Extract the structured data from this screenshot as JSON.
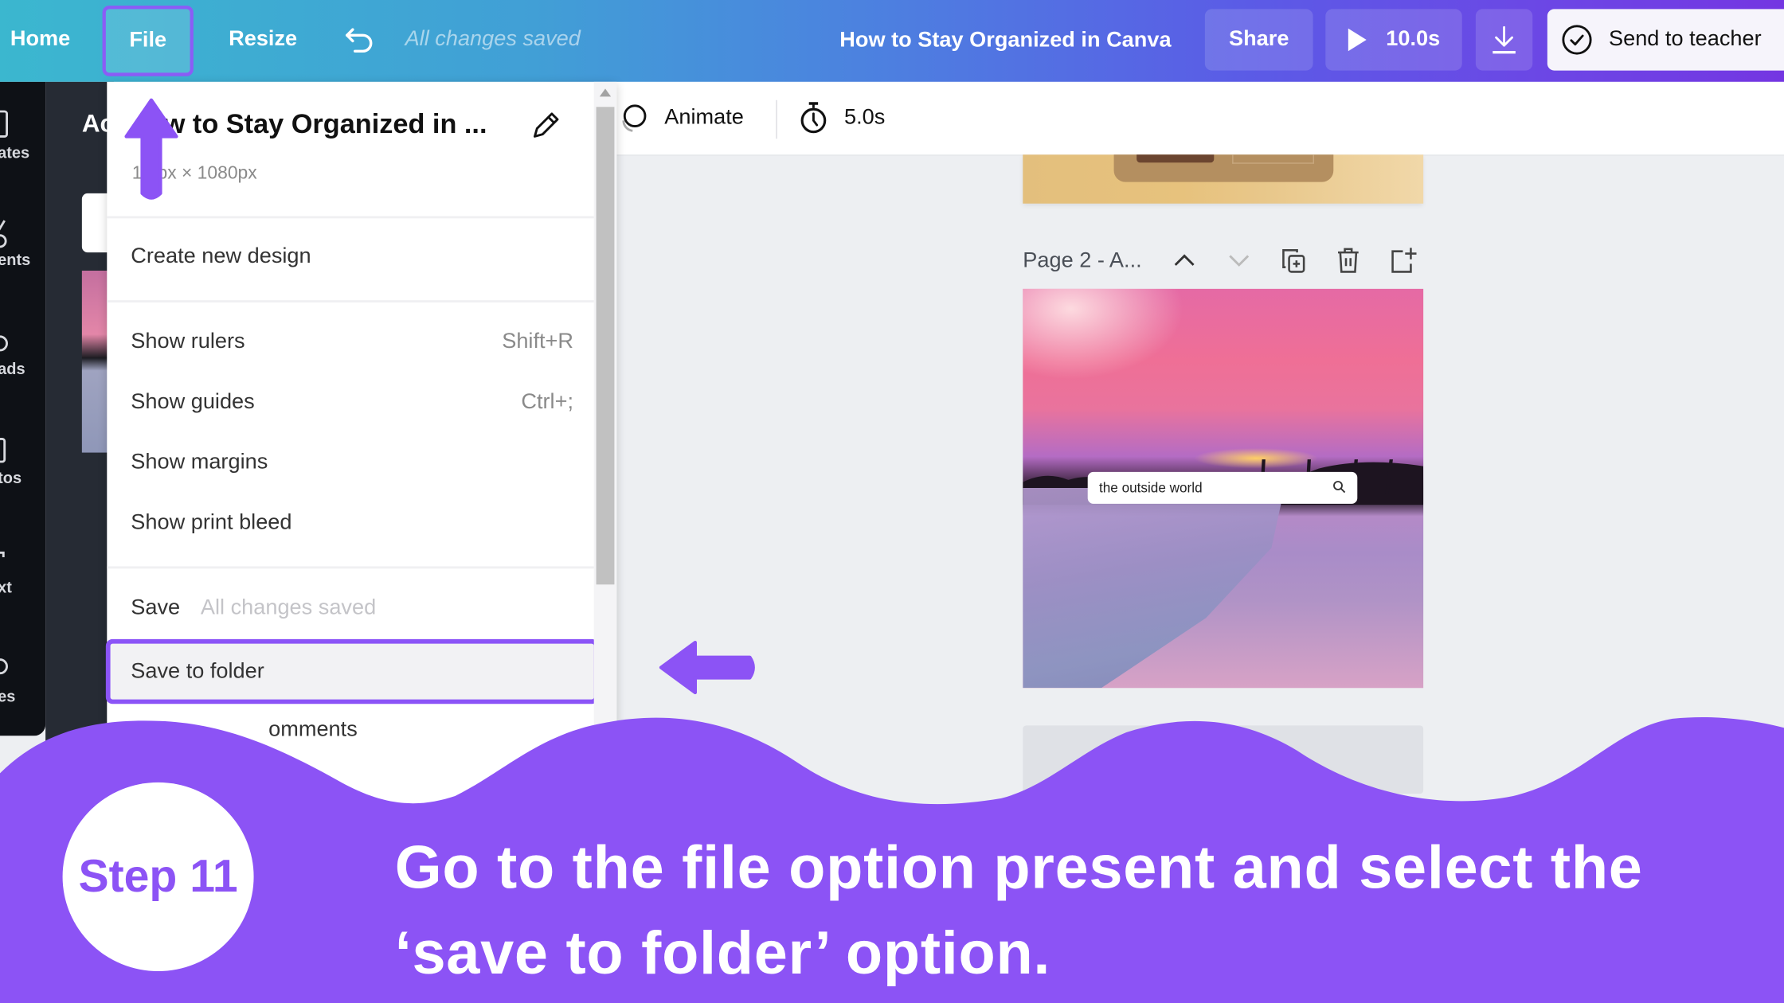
{
  "topbar": {
    "home_label": "Home",
    "file_label": "File",
    "resize_label": "Resize",
    "undo_icon": "undo-icon",
    "save_status": "All changes saved",
    "document_title": "How to Stay Organized in Canva",
    "share_label": "Share",
    "play_duration": "10.0s",
    "download_icon": "download-icon",
    "send_to_teacher_label": "Send to teacher",
    "gradient_colors": [
      "#3bb7cf",
      "#5b5be6",
      "#7436e2"
    ]
  },
  "rail": {
    "items": [
      {
        "label": "ates",
        "icon": "templates-icon"
      },
      {
        "label": "ents",
        "icon": "elements-icon"
      },
      {
        "label": "ads",
        "icon": "uploads-icon"
      },
      {
        "label": "tos",
        "icon": "photos-icon"
      },
      {
        "label": "xt",
        "icon": "text-icon"
      },
      {
        "label": "es",
        "icon": "styles-icon"
      }
    ]
  },
  "side_panel": {
    "title_fragment": "Ac"
  },
  "file_menu": {
    "design_title": "How to Stay Organized in ...",
    "design_title_visible": "w to Stay Organized in ...",
    "dimensions": "1080px × 1080px",
    "dimensions_visible": "1  0px × 1080px",
    "edit_icon": "pencil-icon",
    "items": [
      {
        "label": "Create new design",
        "shortcut": ""
      },
      {
        "label": "Show rulers",
        "shortcut": "Shift+R"
      },
      {
        "label": "Show guides",
        "shortcut": "Ctrl+;"
      },
      {
        "label": "Show margins",
        "shortcut": ""
      },
      {
        "label": "Show print bleed",
        "shortcut": ""
      },
      {
        "label": "Save",
        "sublabel": "All changes saved"
      },
      {
        "label": "Save to folder",
        "highlighted": true
      },
      {
        "label": "...comments",
        "visible_fragment": "omments"
      }
    ]
  },
  "editor_toolbar": {
    "animate_label": "Animate",
    "duration_label": "5.0s"
  },
  "canvas": {
    "page_label": "Page 2 - A...",
    "page_controls": [
      "move-up",
      "move-down",
      "duplicate-page",
      "delete-page",
      "add-page"
    ],
    "search_bar_text": "the outside world"
  },
  "tutorial": {
    "step_label": "Step 11",
    "instruction_line1": "Go to the file option present and select the",
    "instruction_line2": "‘save to folder’ option.",
    "accent_color": "#8c53f5"
  }
}
